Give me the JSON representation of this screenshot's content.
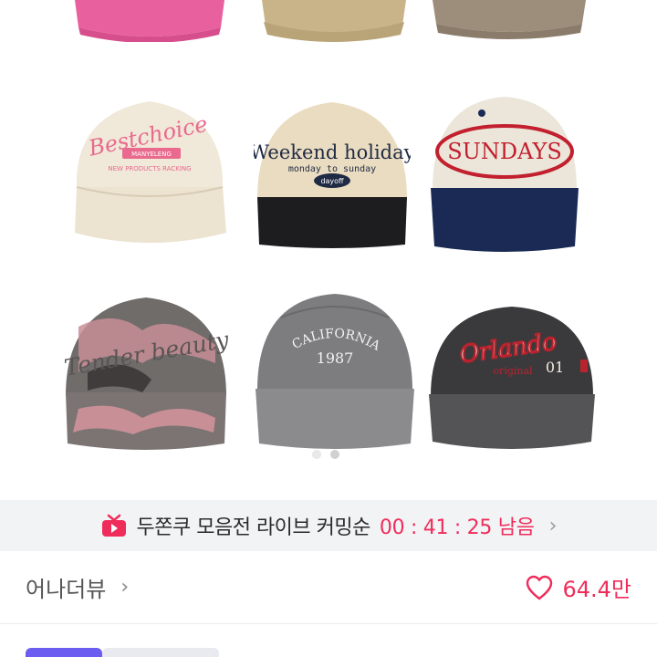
{
  "gallery": {
    "caps": [
      {
        "name": "top-pink-cap",
        "color": "#e85a9a"
      },
      {
        "name": "top-beige-cap",
        "color": "#c8b58c"
      },
      {
        "name": "top-brown-cap",
        "color": "#9a8a78"
      },
      {
        "name": "bestchoice-cap",
        "text": "Bestchoice",
        "color": "#efe6d6"
      },
      {
        "name": "weekend-holiday-cap",
        "text": "Weekend holiday",
        "sub": "monday to sunday",
        "tag": "dayoff"
      },
      {
        "name": "sundays-cap",
        "text": "SUNDAYS"
      },
      {
        "name": "tender-beauty-cap",
        "text": "Tender beauty"
      },
      {
        "name": "california-cap",
        "text": "CALIFORNIA",
        "sub": "1987"
      },
      {
        "name": "orlando-cap",
        "text": "Orlando",
        "sub": "original",
        "num": "01"
      }
    ],
    "pager": {
      "current": 1,
      "total": 2
    },
    "expand_icon": "expand-icon"
  },
  "live": {
    "icon": "live-tv-icon",
    "title": "두쫀쿠 모음전 라이브 커밍순",
    "timer": "00 : 41 : 25 남음",
    "chevron": "›",
    "accent": "#ef2d5b"
  },
  "product": {
    "brand": "어나더뷰",
    "brand_chevron": "›",
    "likes": "64.4만"
  },
  "colors": {
    "accent": "#ef2d5b",
    "tab": "#6a5df0"
  }
}
